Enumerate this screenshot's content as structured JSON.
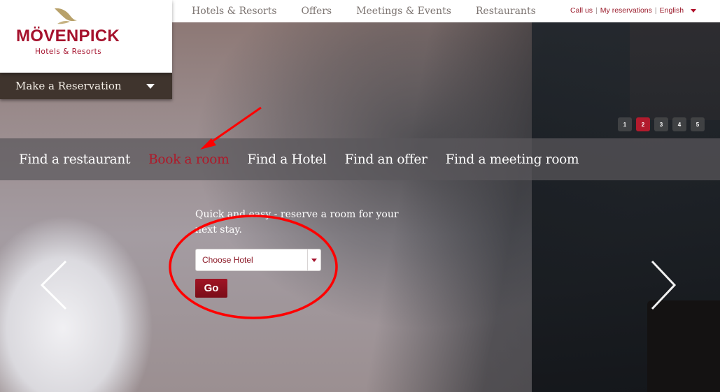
{
  "brand": {
    "name": "MÖVENPICK",
    "tagline": "Hotels & Resorts",
    "color": "#a5122d"
  },
  "top_nav": {
    "items": [
      "Hotels & Resorts",
      "Offers",
      "Meetings & Events",
      "Restaurants"
    ]
  },
  "utility_nav": {
    "call_us": "Call us",
    "my_reservations": "My reservations",
    "language": "English",
    "separator": "|"
  },
  "reservation_bar": {
    "label": "Make a Reservation",
    "icon": "caret-down-icon"
  },
  "slider": {
    "pages": [
      "1",
      "2",
      "3",
      "4",
      "5"
    ],
    "active_page": "2",
    "prev_icon": "chevron-left-icon",
    "next_icon": "chevron-right-icon"
  },
  "search_tabs": {
    "items": [
      "Find a restaurant",
      "Book a room",
      "Find a Hotel",
      "Find an offer",
      "Find a meeting room"
    ],
    "active": "Book a room",
    "active_color": "#b01828"
  },
  "booking": {
    "intro": "Quick and easy - reserve a room for your next stay.",
    "hotel_select_value": "Choose Hotel",
    "go_label": "Go"
  },
  "annotations": {
    "color": "#ff0000",
    "arrow_target": "Book a room",
    "circle_target": "booking-form"
  }
}
